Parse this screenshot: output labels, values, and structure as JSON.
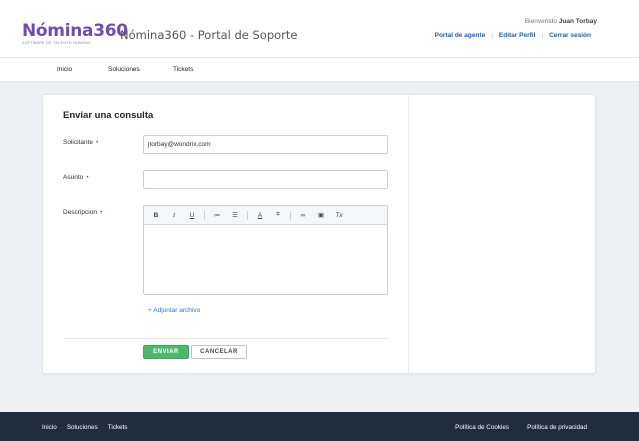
{
  "header": {
    "logo_main": "Nómina360",
    "logo_sub": "SOFTWARE DE TALENTO HUMANO",
    "portal_title": "Nómina360 - Portal de Soporte",
    "welcome_prefix": "Bienvenido",
    "user_name": "Juan Torbay",
    "links": [
      "Portal de agente",
      "Editar Perfil",
      "Cerrar sesión"
    ]
  },
  "nav": {
    "items": [
      "Inicio",
      "Soluciones",
      "Tickets"
    ]
  },
  "form": {
    "title": "Enviar una consulta",
    "requester_label": "Solicitante",
    "requester_value": "jtorbay@wondrix.com",
    "subject_label": "Asunto",
    "subject_value": "",
    "description_label": "Descripcion",
    "required_mark": "•",
    "toolbar": {
      "bold": "B",
      "italic": "I",
      "underline": "U",
      "bullet_list": "≔",
      "numbered_list": "☰",
      "font_color": "A",
      "highlight": "⌗",
      "link": "∞",
      "image": "▣",
      "clear_format": "Tx"
    },
    "attach_label": "+ Adjuntar archivo",
    "submit_label": "ENVIAR",
    "cancel_label": "CANCELAR"
  },
  "footer": {
    "left": [
      "Inicio",
      "Soluciones",
      "Tickets"
    ],
    "separator": "·",
    "right": [
      "Política de Cookies",
      "Política de privacidad"
    ]
  },
  "colors": {
    "brand": "#6f4cb3",
    "link": "#1f5fb8",
    "submit": "#4cb86d",
    "footer": "#1f2d3f",
    "required": "#d9363e"
  }
}
